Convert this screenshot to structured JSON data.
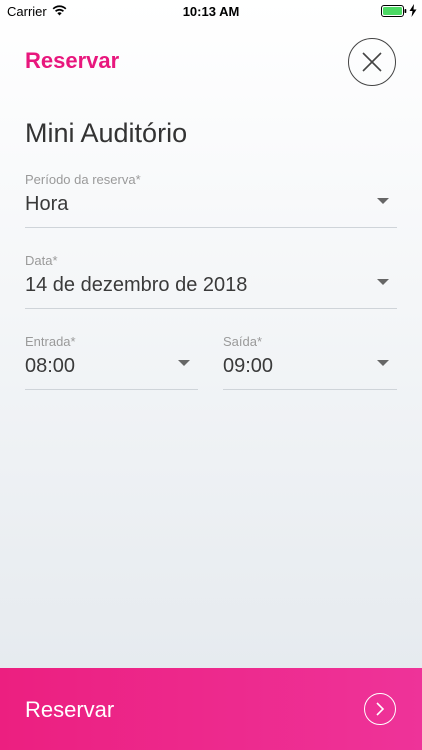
{
  "status_bar": {
    "carrier": "Carrier",
    "time": "10:13 AM",
    "wifi_icon": "wifi-icon",
    "battery_icon": "battery-full-icon",
    "charging_icon": "bolt-icon"
  },
  "header": {
    "title": "Reservar",
    "close_icon": "close-icon",
    "accent_color": "#e8177d"
  },
  "room": {
    "name": "Mini Auditório"
  },
  "form": {
    "period": {
      "label": "Período da reserva*",
      "value": "Hora"
    },
    "date": {
      "label": "Data*",
      "value": "14 de dezembro de 2018"
    },
    "entry": {
      "label": "Entrada*",
      "value": "08:00"
    },
    "exit": {
      "label": "Saída*",
      "value": "09:00"
    }
  },
  "footer": {
    "button_label": "Reservar",
    "arrow_icon": "chevron-right-icon",
    "color": "#ec1f80"
  }
}
